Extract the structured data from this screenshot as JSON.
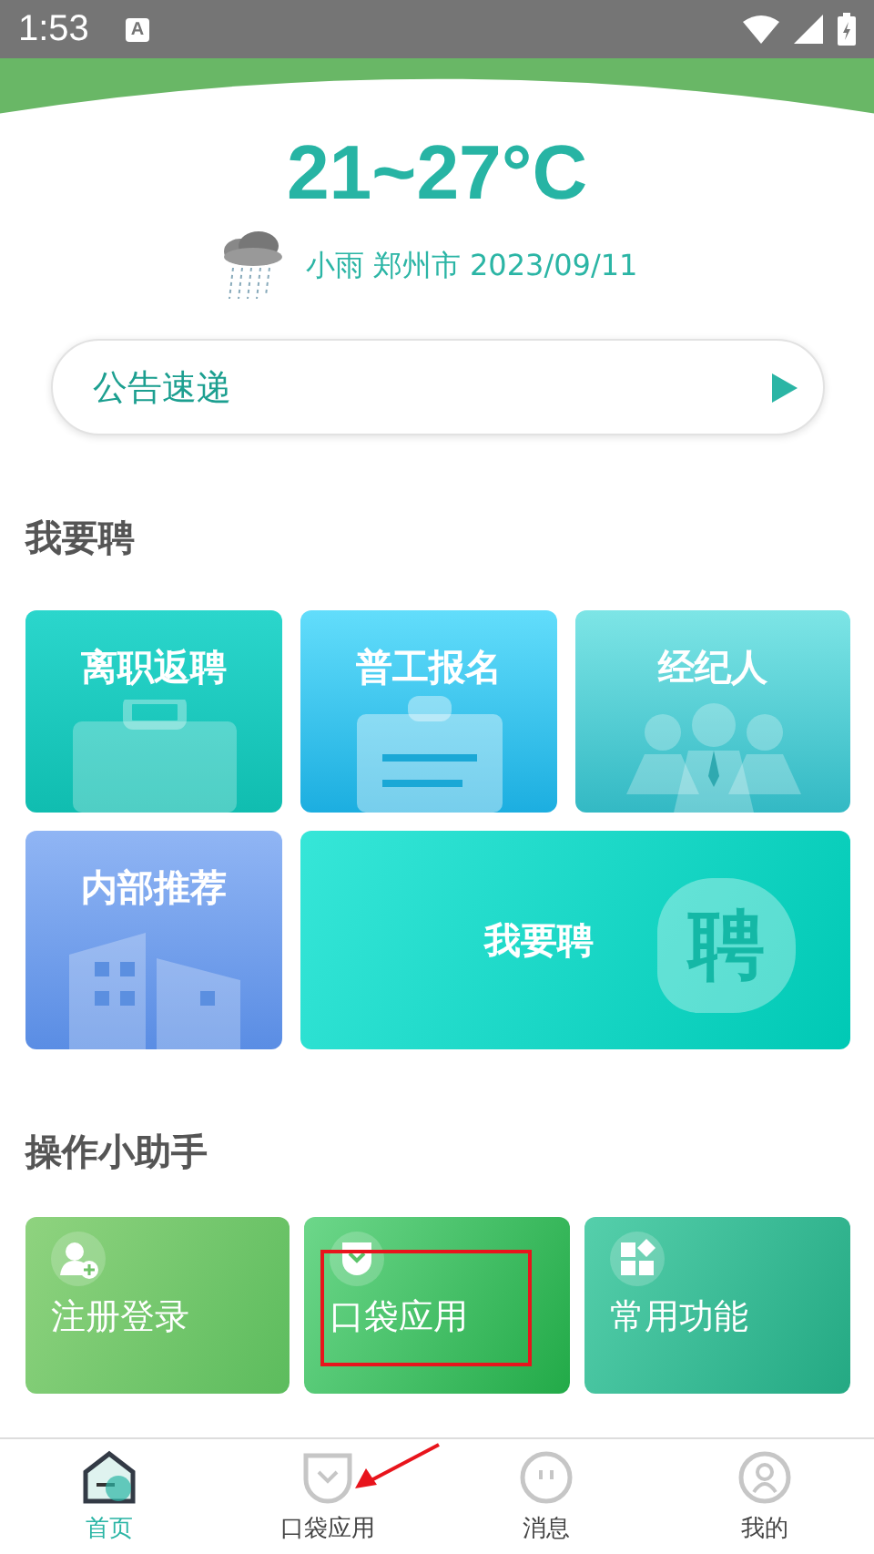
{
  "status_bar": {
    "time": "1:53",
    "notification": "A"
  },
  "weather": {
    "temperature": "21~27°C",
    "condition": "小雨",
    "city": "郑州市",
    "date": "2023/09/11"
  },
  "notice": {
    "label": "公告速递"
  },
  "recruit": {
    "title": "我要聘",
    "cards": [
      {
        "label": "离职返聘",
        "kind": "briefcase"
      },
      {
        "label": "普工报名",
        "kind": "clipboard"
      },
      {
        "label": "经纪人",
        "kind": "people"
      },
      {
        "label": "内部推荐",
        "kind": "building"
      },
      {
        "label": "我要聘",
        "kind": "hire",
        "badge": "聘"
      }
    ]
  },
  "assistant": {
    "title": "操作小助手",
    "cards": [
      {
        "label": "注册登录",
        "kind": "register"
      },
      {
        "label": "口袋应用",
        "kind": "pocket"
      },
      {
        "label": "常用功能",
        "kind": "apps"
      }
    ]
  },
  "nav": [
    {
      "label": "首页",
      "kind": "home",
      "selected": true
    },
    {
      "label": "口袋应用",
      "kind": "pocket",
      "selected": false
    },
    {
      "label": "消息",
      "kind": "chat",
      "selected": false
    },
    {
      "label": "我的",
      "kind": "user",
      "selected": false
    }
  ],
  "annotations": {
    "highlight_box": true,
    "pointer_arrow": true
  }
}
